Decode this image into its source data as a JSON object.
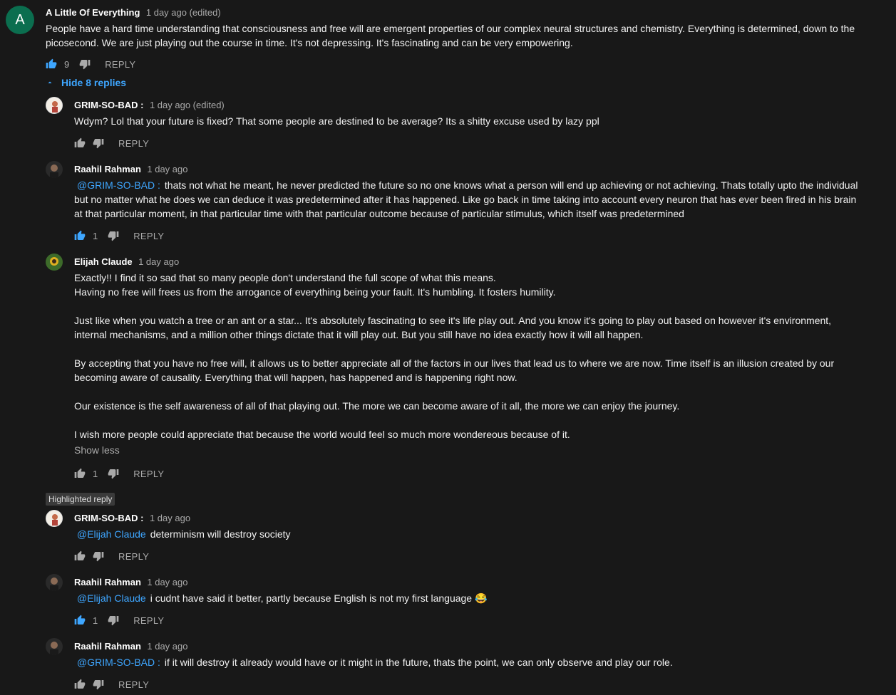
{
  "top_comment": {
    "avatar_letter": "A",
    "author": "A Little Of Everything",
    "time": "1 day ago (edited)",
    "text_line1": "People have a hard time understanding that consciousness and free will are emergent properties of our complex neural structures and chemistry. Everything is determined, down to the",
    "text_line2": "picosecond. We are just playing out the course in time. It's not depressing. It's fascinating and can be very empowering.",
    "likes": "9",
    "reply_label": "REPLY"
  },
  "hide_replies_label": "Hide 8 replies",
  "replies": [
    {
      "author": "GRIM-SO-BAD :",
      "time": "1 day ago (edited)",
      "text": "Wdym? Lol that your future is fixed? That some people are destined to be average? Its a shitty excuse used by lazy ppl",
      "reply_label": "REPLY"
    },
    {
      "author": "Raahil Rahman",
      "time": "1 day ago",
      "mention": "@GRIM-SO-BAD :",
      "text_line1": "thats not what he meant, he never predicted the future so no one knows what a person will end up achieving or not achieving. Thats totally upto the individual",
      "text_line2": "but no matter what he does we can deduce it was predetermined after it has happened. Like go back in time taking into account every neuron that has ever been fired in his brain",
      "text_line3": "at that particular moment, in that particular time with that particular outcome because of particular stimulus, which itself was predetermined",
      "likes": "1",
      "reply_label": "REPLY"
    },
    {
      "author": "Elijah Claude",
      "time": "1 day ago",
      "lines": [
        "Exactly!! I find it so sad that so many people don't understand the full scope of what this means.",
        "Having no free will frees us from the arrogance of everything being your fault. It's humbling. It fosters humility.",
        "Just like when you watch a tree or an ant or a star... It's absolutely fascinating to see it's life play out. And you know it's going to play out based on however it's environment,",
        "internal mechanisms, and a million other things dictate that it will play out. But you still have no idea exactly how it will all happen.",
        "By accepting that you have no free will, it allows us to better appreciate all of the factors in our lives that lead us to where we are now. Time itself is an illusion created by our",
        "becoming aware of causality. Everything that will happen, has happened and is happening right now.",
        "Our existence is the self awareness of all of that playing out. The more we can become aware of it all, the more we can enjoy the journey.",
        "I wish more people could appreciate that because the world would feel so much more wondereous because of it."
      ],
      "show_less": "Show less",
      "likes": "1",
      "reply_label": "REPLY"
    },
    {
      "badge": "Highlighted reply",
      "author": "GRIM-SO-BAD :",
      "time": "1 day ago",
      "mention": "@Elijah Claude",
      "text": "determinism will destroy society",
      "reply_label": "REPLY"
    },
    {
      "author": "Raahil Rahman",
      "time": "1 day ago",
      "mention": "@Elijah Claude",
      "text": "i cudnt have said it better, partly because English is not my first language 😂",
      "likes": "1",
      "reply_label": "REPLY"
    },
    {
      "author": "Raahil Rahman",
      "time": "1 day ago",
      "mention": "@GRIM-SO-BAD :",
      "text": "if it will destroy it already would have or it might in the future, thats the point, we can only observe and play our role.",
      "reply_label": "REPLY"
    }
  ],
  "colors": {
    "accent": "#3ea6ff",
    "background": "#181818",
    "text": "#f1f1f1",
    "muted": "#aaaaaa"
  },
  "icons": [
    "thumbs-up-icon",
    "thumbs-down-icon",
    "chevron-up-icon"
  ]
}
